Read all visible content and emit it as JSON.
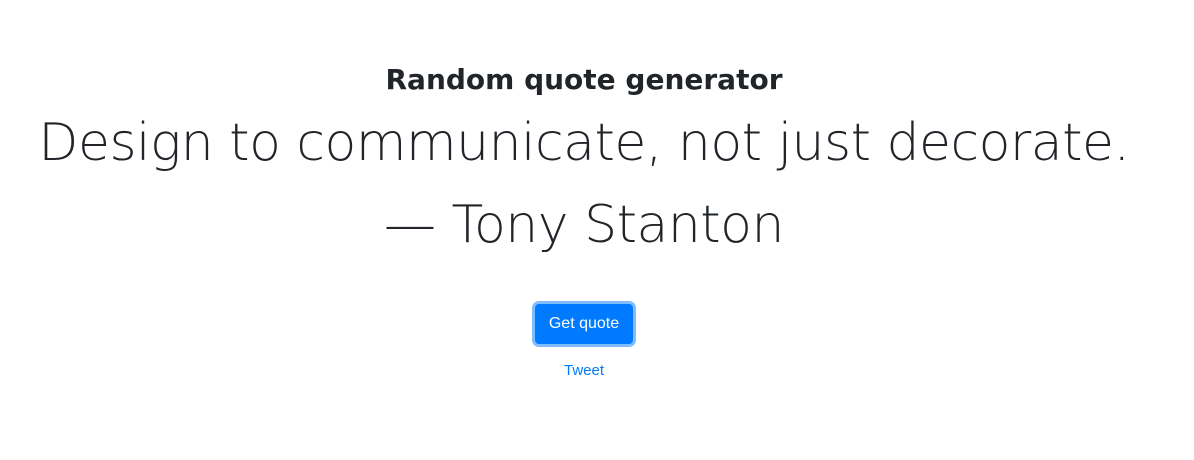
{
  "header": {
    "title": "Random quote generator"
  },
  "quote": {
    "text": "Design to communicate, not just decorate.",
    "author": "— Tony Stanton"
  },
  "actions": {
    "get_quote_label": "Get quote",
    "tweet_label": "Tweet"
  },
  "colors": {
    "primary": "#007bff",
    "text": "#212529",
    "background": "#ffffff"
  }
}
